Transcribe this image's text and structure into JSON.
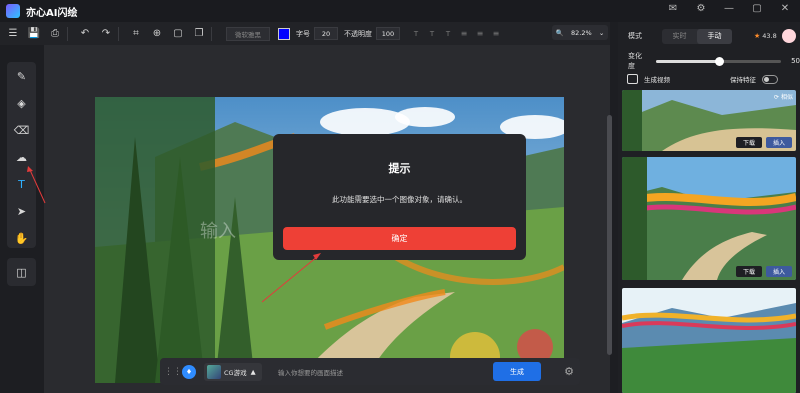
{
  "app": {
    "title": "亦心AI闪绘",
    "window_controls": [
      "✉",
      "⚙",
      "—",
      "▢",
      "✕"
    ]
  },
  "toolbar": {
    "font_placeholder": "微软雅黑",
    "text_color": "#0000ff",
    "font_size_label": "字号",
    "font_size": "20",
    "opacity_label": "不透明度",
    "opacity": "100",
    "zoom_value": "82.2%"
  },
  "left_tools": [
    {
      "name": "brush-icon",
      "glyph": "✎"
    },
    {
      "name": "fill-icon",
      "glyph": "◈"
    },
    {
      "name": "eraser-icon",
      "glyph": "⌫"
    },
    {
      "name": "lasso-icon",
      "glyph": "☁"
    },
    {
      "name": "text-icon",
      "glyph": "T"
    },
    {
      "name": "select-arrow-icon",
      "glyph": "➤"
    },
    {
      "name": "hand-icon",
      "glyph": "✋"
    }
  ],
  "canvas": {
    "watermark": "输入",
    "image_colors": {
      "sky": "#7fb3d9",
      "grass": "#6aa046",
      "mountain": "#4f7a54"
    }
  },
  "dialog": {
    "title": "提示",
    "message": "此功能需要选中一个图像对象，请确认。",
    "confirm_label": "确定"
  },
  "prompt_bar": {
    "model_name": "CG游戏",
    "placeholder": "输入你想要的画面描述",
    "generate_label": "生成"
  },
  "right_panel": {
    "mode_label": "模式",
    "modes": [
      "实时",
      "手动"
    ],
    "active_mode": "手动",
    "credits": "43.8",
    "strength_label": "变化度",
    "strength_value": "50",
    "generate_video_label": "生成视频",
    "keep_features_label": "保持特征",
    "similar_label": "相似",
    "download_label": "下载",
    "insert_label": "插入"
  }
}
